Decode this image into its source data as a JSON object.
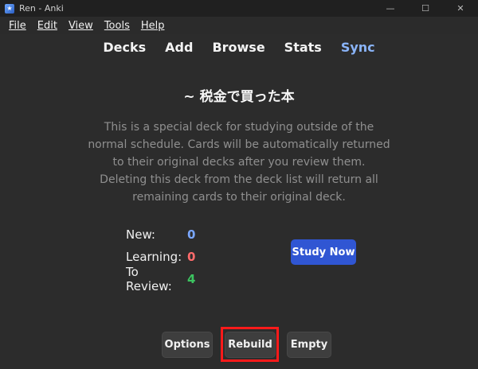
{
  "window": {
    "title": "Ren - Anki",
    "controls": {
      "minimize": "—",
      "maximize": "☐",
      "close": "✕"
    }
  },
  "menu": [
    "File",
    "Edit",
    "View",
    "Tools",
    "Help"
  ],
  "nav": {
    "items": [
      {
        "label": "Decks"
      },
      {
        "label": "Add"
      },
      {
        "label": "Browse"
      },
      {
        "label": "Stats"
      },
      {
        "label": "Sync"
      }
    ]
  },
  "deck": {
    "title": "~ 税金で買った本",
    "description": "This is a special deck for studying outside of the normal schedule. Cards will be automatically returned to their original decks after you review them. Deleting this deck from the deck list will return all remaining cards to their original deck."
  },
  "counts": {
    "new_label": "New:",
    "new_value": "0",
    "learning_label": "Learning:",
    "learning_value": "0",
    "review_label": "To Review:",
    "review_value": "4"
  },
  "buttons": {
    "study_now": "Study Now",
    "options": "Options",
    "rebuild": "Rebuild",
    "empty": "Empty"
  },
  "colors": {
    "accent": "#3056d3",
    "new": "#7aa7ff",
    "learning": "#ff6b6b",
    "review": "#3cc460",
    "highlight": "#ff1a1a"
  }
}
